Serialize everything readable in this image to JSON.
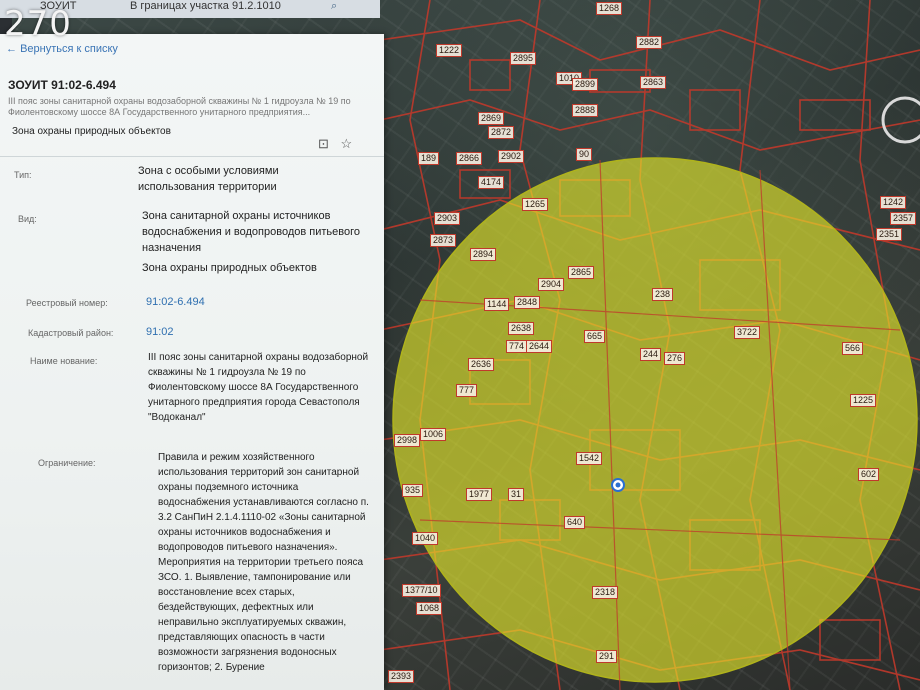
{
  "watermark": "270",
  "topbar": {
    "left": "ЗОУИТ",
    "center": "В границах участка 91.2.1010"
  },
  "panel": {
    "back_link": "Вернуться к списку",
    "title": "ЗОУИТ 91:02-6.494",
    "subtitle": "III пояс зоны санитарной охраны водозаборной скважины № 1 гидроузла № 19 по Фиолентовскому шоссе 8А Государственного унитарного предприятия...",
    "zone_type": "Зона охраны природных объектов",
    "fields": {
      "type_label": "Тип:",
      "type_value": "Зона с особыми условиями использования территории",
      "kind_label": "Вид:",
      "kind_value_1": "Зона санитарной охраны источников водоснабжения и водопроводов питьевого назначения",
      "kind_value_2": "Зона охраны природных объектов",
      "registry_label": "Реестровый номер:",
      "registry_value": "91:02-6.494",
      "district_label": "Кадастровый район:",
      "district_value": "91:02",
      "name_label": "Наиме нование:",
      "name_value": "III пояс зоны санитарной охраны водозаборной скважины № 1 гидроузла № 19 по Фиолентовскому шоссе 8А Государственного унитарного предприятия города Севастополя \"Водоканал\"",
      "restriction_label": "Ограничение:",
      "restriction_value": "Правила и режим хозяйственного использования территорий зон санитарной охраны подземного источника водоснабжения устанавливаются согласно п. 3.2 СанПиН 2.1.4.1110-02 «Зоны санитарной охраны источников водоснабжения и водопроводов питьевого назначения». Мероприятия на территории третьего пояса ЗСО. 1. Выявление, тампонирование или восстановление всех старых, бездействующих, дефектных или неправильно эксплуатируемых скважин, представляющих опасность в части возможности загрязнения водоносных горизонтов; 2. Бурение"
    }
  },
  "map": {
    "parcels": [
      "1268",
      "2882",
      "1222",
      "2895",
      "1010",
      "2899",
      "2888",
      "2863",
      "2869",
      "2872",
      "2866",
      "2902",
      "4174",
      "2903",
      "2873",
      "2894",
      "2904",
      "2865",
      "1265",
      "1144",
      "2848",
      "238",
      "2638",
      "665",
      "774",
      "2644",
      "2636",
      "777",
      "276",
      "244",
      "3722",
      "566",
      "1040",
      "1542",
      "2998",
      "1006",
      "935",
      "1977",
      "31",
      "640",
      "2318",
      "291",
      "1068",
      "1377/10",
      "2393",
      "2357",
      "2351",
      "1242",
      "602",
      "189",
      "90",
      "1225"
    ],
    "colors": {
      "zone_fill": "#e9ec2a",
      "boundary": "#c0392b"
    }
  }
}
